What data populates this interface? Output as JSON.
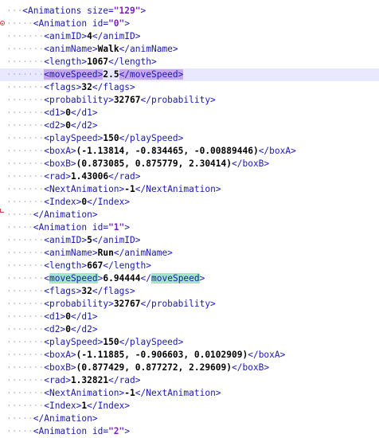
{
  "lines": [
    {
      "indent": 0,
      "parts": [
        {
          "c": "tag",
          "t": "<Animations "
        },
        {
          "c": "attr",
          "t": "size="
        },
        {
          "c": "val",
          "t": "\"129\""
        },
        {
          "c": "tag",
          "t": ">"
        }
      ]
    },
    {
      "indent": 1,
      "parts": [
        {
          "c": "tag",
          "t": "<Animation "
        },
        {
          "c": "attr",
          "t": "id="
        },
        {
          "c": "val",
          "t": "\"0\""
        },
        {
          "c": "tag",
          "t": ">"
        }
      ]
    },
    {
      "indent": 2,
      "parts": [
        {
          "c": "tag",
          "t": "<animID>"
        },
        {
          "c": "text",
          "t": "4"
        },
        {
          "c": "tag",
          "t": "</animID>"
        }
      ]
    },
    {
      "indent": 2,
      "parts": [
        {
          "c": "tag",
          "t": "<animName>"
        },
        {
          "c": "text",
          "t": "Walk"
        },
        {
          "c": "tag",
          "t": "</animName>"
        }
      ]
    },
    {
      "indent": 2,
      "parts": [
        {
          "c": "tag",
          "t": "<length>"
        },
        {
          "c": "text",
          "t": "1067"
        },
        {
          "c": "tag",
          "t": "</length>"
        }
      ]
    },
    {
      "indent": 2,
      "parts": [
        {
          "c": "tag hl-purple",
          "t": "<moveSpeed>"
        },
        {
          "c": "text",
          "t": "2.5"
        },
        {
          "c": "tag hl-purple",
          "t": "</moveSpeed>"
        }
      ]
    },
    {
      "indent": 2,
      "parts": [
        {
          "c": "tag",
          "t": "<flags>"
        },
        {
          "c": "text",
          "t": "32"
        },
        {
          "c": "tag",
          "t": "</flags>"
        }
      ]
    },
    {
      "indent": 2,
      "parts": [
        {
          "c": "tag",
          "t": "<probability>"
        },
        {
          "c": "text",
          "t": "32767"
        },
        {
          "c": "tag",
          "t": "</probability>"
        }
      ]
    },
    {
      "indent": 2,
      "parts": [
        {
          "c": "tag",
          "t": "<d1>"
        },
        {
          "c": "text",
          "t": "0"
        },
        {
          "c": "tag",
          "t": "</d1>"
        }
      ]
    },
    {
      "indent": 2,
      "parts": [
        {
          "c": "tag",
          "t": "<d2>"
        },
        {
          "c": "text",
          "t": "0"
        },
        {
          "c": "tag",
          "t": "</d2>"
        }
      ]
    },
    {
      "indent": 2,
      "parts": [
        {
          "c": "tag",
          "t": "<playSpeed>"
        },
        {
          "c": "text",
          "t": "150"
        },
        {
          "c": "tag",
          "t": "</playSpeed>"
        }
      ]
    },
    {
      "indent": 2,
      "parts": [
        {
          "c": "tag",
          "t": "<boxA>"
        },
        {
          "c": "text",
          "t": "(-1.13814, -0.834465, -0.00889446)"
        },
        {
          "c": "tag",
          "t": "</boxA>"
        }
      ]
    },
    {
      "indent": 2,
      "parts": [
        {
          "c": "tag",
          "t": "<boxB>"
        },
        {
          "c": "text",
          "t": "(0.873085, 0.875779, 2.30414)"
        },
        {
          "c": "tag",
          "t": "</boxB>"
        }
      ]
    },
    {
      "indent": 2,
      "parts": [
        {
          "c": "tag",
          "t": "<rad>"
        },
        {
          "c": "text",
          "t": "1.43006"
        },
        {
          "c": "tag",
          "t": "</rad>"
        }
      ]
    },
    {
      "indent": 2,
      "parts": [
        {
          "c": "tag",
          "t": "<NextAnimation>"
        },
        {
          "c": "text",
          "t": "-1"
        },
        {
          "c": "tag",
          "t": "</NextAnimation>"
        }
      ]
    },
    {
      "indent": 2,
      "parts": [
        {
          "c": "tag",
          "t": "<Index>"
        },
        {
          "c": "text",
          "t": "0"
        },
        {
          "c": "tag",
          "t": "</Index>"
        }
      ]
    },
    {
      "indent": 1,
      "parts": [
        {
          "c": "tag",
          "t": "</Animation>"
        }
      ]
    },
    {
      "indent": 1,
      "parts": [
        {
          "c": "tag",
          "t": "<Animation "
        },
        {
          "c": "attr",
          "t": "id="
        },
        {
          "c": "val",
          "t": "\"1\""
        },
        {
          "c": "tag",
          "t": ">"
        }
      ]
    },
    {
      "indent": 2,
      "parts": [
        {
          "c": "tag",
          "t": "<animID>"
        },
        {
          "c": "text",
          "t": "5"
        },
        {
          "c": "tag",
          "t": "</animID>"
        }
      ]
    },
    {
      "indent": 2,
      "parts": [
        {
          "c": "tag",
          "t": "<animName>"
        },
        {
          "c": "text",
          "t": "Run"
        },
        {
          "c": "tag",
          "t": "</animName>"
        }
      ]
    },
    {
      "indent": 2,
      "parts": [
        {
          "c": "tag",
          "t": "<length>"
        },
        {
          "c": "text",
          "t": "667"
        },
        {
          "c": "tag",
          "t": "</length>"
        }
      ]
    },
    {
      "indent": 2,
      "parts": [
        {
          "c": "tag",
          "t": "<"
        },
        {
          "c": "tag hl-green",
          "t": "moveSpeed"
        },
        {
          "c": "tag",
          "t": ">"
        },
        {
          "c": "text",
          "t": "6.94444"
        },
        {
          "c": "tag",
          "t": "</"
        },
        {
          "c": "tag hl-green",
          "t": "moveSpeed"
        },
        {
          "c": "tag",
          "t": ">"
        }
      ]
    },
    {
      "indent": 2,
      "parts": [
        {
          "c": "tag",
          "t": "<flags>"
        },
        {
          "c": "text",
          "t": "32"
        },
        {
          "c": "tag",
          "t": "</flags>"
        }
      ]
    },
    {
      "indent": 2,
      "parts": [
        {
          "c": "tag",
          "t": "<probability>"
        },
        {
          "c": "text",
          "t": "32767"
        },
        {
          "c": "tag",
          "t": "</probability>"
        }
      ]
    },
    {
      "indent": 2,
      "parts": [
        {
          "c": "tag",
          "t": "<d1>"
        },
        {
          "c": "text",
          "t": "0"
        },
        {
          "c": "tag",
          "t": "</d1>"
        }
      ]
    },
    {
      "indent": 2,
      "parts": [
        {
          "c": "tag",
          "t": "<d2>"
        },
        {
          "c": "text",
          "t": "0"
        },
        {
          "c": "tag",
          "t": "</d2>"
        }
      ]
    },
    {
      "indent": 2,
      "parts": [
        {
          "c": "tag",
          "t": "<playSpeed>"
        },
        {
          "c": "text",
          "t": "150"
        },
        {
          "c": "tag",
          "t": "</playSpeed>"
        }
      ]
    },
    {
      "indent": 2,
      "parts": [
        {
          "c": "tag",
          "t": "<boxA>"
        },
        {
          "c": "text",
          "t": "(-1.11885, -0.906603, 0.0102909)"
        },
        {
          "c": "tag",
          "t": "</boxA>"
        }
      ]
    },
    {
      "indent": 2,
      "parts": [
        {
          "c": "tag",
          "t": "<boxB>"
        },
        {
          "c": "text",
          "t": "(0.877429, 0.877272, 2.29609)"
        },
        {
          "c": "tag",
          "t": "</boxB>"
        }
      ]
    },
    {
      "indent": 2,
      "parts": [
        {
          "c": "tag",
          "t": "<rad>"
        },
        {
          "c": "text",
          "t": "1.32821"
        },
        {
          "c": "tag",
          "t": "</rad>"
        }
      ]
    },
    {
      "indent": 2,
      "parts": [
        {
          "c": "tag",
          "t": "<NextAnimation>"
        },
        {
          "c": "text",
          "t": "-1"
        },
        {
          "c": "tag",
          "t": "</NextAnimation>"
        }
      ]
    },
    {
      "indent": 2,
      "parts": [
        {
          "c": "tag",
          "t": "<Index>"
        },
        {
          "c": "text",
          "t": "1"
        },
        {
          "c": "tag",
          "t": "</Index>"
        }
      ]
    },
    {
      "indent": 1,
      "parts": [
        {
          "c": "tag",
          "t": "</Animation>"
        }
      ]
    },
    {
      "indent": 1,
      "parts": [
        {
          "c": "tag",
          "t": "<Animation "
        },
        {
          "c": "attr",
          "t": "id="
        },
        {
          "c": "val",
          "t": "\"2\""
        },
        {
          "c": "tag",
          "t": ">"
        }
      ]
    }
  ],
  "current_line": 5,
  "fold_open_lines": [
    1
  ],
  "fold_close_lines": [
    16
  ],
  "colors": {
    "tag": "#1a1ab0",
    "value": "#7a1fc4",
    "text": "#000000",
    "match_highlight": "#c7a8f0",
    "occurrence_highlight": "#a0e6c8",
    "current_line": "#e8e8ff",
    "fold_marker": "#d04040"
  }
}
